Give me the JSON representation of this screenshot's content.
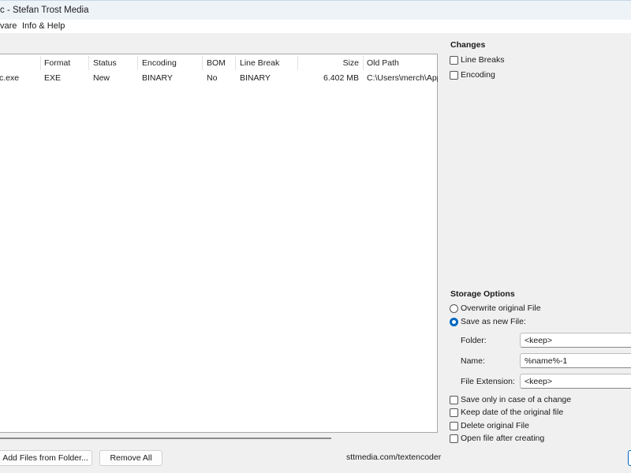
{
  "window": {
    "title": "c - Stefan Trost Media"
  },
  "menu": [
    "vare",
    "Info & Help"
  ],
  "list": {
    "columns": [
      "Format",
      "Status",
      "Encoding",
      "BOM",
      "Line Break",
      "Size",
      "Old Path"
    ],
    "rows": [
      {
        "name": "c.exe",
        "format": "EXE",
        "status": "New",
        "encoding": "BINARY",
        "bom": "No",
        "line_break": "BINARY",
        "size": "6.402 MB",
        "old_path": "C:\\Users\\merch\\App"
      }
    ]
  },
  "buttons": {
    "add_folder": "Add Files from Folder...",
    "remove_all": "Remove All"
  },
  "link": "sttmedia.com/textencoder",
  "changes": {
    "title": "Changes",
    "line_breaks": "Line Breaks",
    "encoding": "Encoding"
  },
  "storage": {
    "title": "Storage Options",
    "overwrite": "Overwrite original File",
    "save_new": "Save as new File:",
    "selected": "save_new",
    "folder_label": "Folder:",
    "folder_value": "<keep>",
    "name_label": "Name:",
    "name_value": "%name%-1",
    "ext_label": "File Extension:",
    "ext_value": "<keep>",
    "opt_change": "Save only in case of a change",
    "opt_date": "Keep date of the original file",
    "opt_delete": "Delete original File",
    "opt_open": "Open file after creating"
  }
}
